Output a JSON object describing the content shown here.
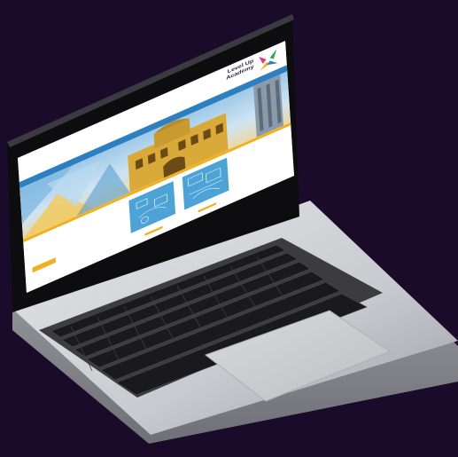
{
  "colors": {
    "background": "#1b0b2a",
    "nav": "#2e7fbf",
    "accent": "#f2b01e",
    "card": "#4da3d6"
  },
  "site": {
    "logo_text": "Level Up\nAcademy"
  },
  "nav_items": [
    "",
    "",
    "",
    "",
    "",
    ""
  ]
}
